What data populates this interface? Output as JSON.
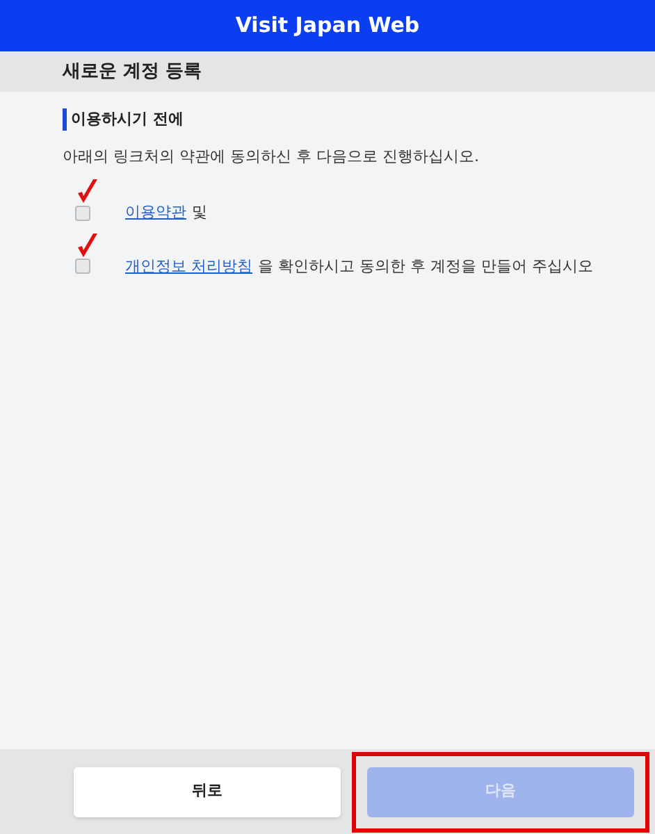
{
  "header": {
    "title": "Visit Japan Web"
  },
  "page_title": "새로운 계정 등록",
  "section": {
    "heading": "이용하시기 전에",
    "intro": "아래의 링크처의 약관에 동의하신 후 다음으로 진행하십시오.",
    "agreements": [
      {
        "link": "이용약관",
        "text": "및",
        "checked": false,
        "annotated": true
      },
      {
        "link": "개인정보 처리방침",
        "text": "을 확인하시고 동의한 후 계정을 만들어 주십시오",
        "checked": false,
        "annotated": true
      }
    ]
  },
  "footer": {
    "buttons": [
      {
        "label": "뒤로",
        "kind": "secondary",
        "disabled": false,
        "highlighted": false
      },
      {
        "label": "다음",
        "kind": "primary",
        "disabled": true,
        "highlighted": true
      }
    ]
  }
}
